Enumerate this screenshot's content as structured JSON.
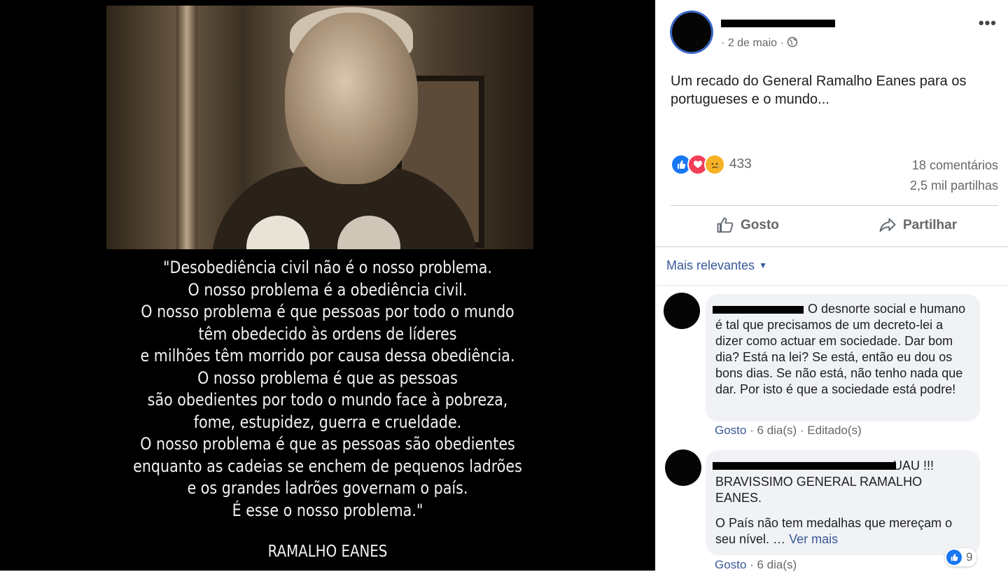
{
  "media": {
    "quote": "\"Desobediência civil não é o nosso problema.\nO nosso problema é a obediência civil.\nO nosso problema é que pessoas por todo o mundo\ntêm obedecido às ordens de líderes\ne milhões têm morrido por causa dessa obediência.\nO nosso problema é que as pessoas\nsão obedientes por todo o mundo face à pobreza,\nfome, estupidez, guerra e crueldade.\nO nosso problema é que as pessoas são obedientes\nenquanto as cadeias se enchem de pequenos ladrões\ne os grandes ladrões governam o país.\nÉ esse o nosso problema.\"",
    "author": "RAMALHO EANES"
  },
  "post": {
    "date": "· 2 de maio ·",
    "globe_icon": "globe-icon",
    "more_label": "•••",
    "text": "Um recado do General Ramalho Eanes para os portugueses e o mundo...",
    "reaction_icons": [
      "like-icon",
      "love-icon",
      "sad-icon"
    ],
    "reaction_count": "433",
    "comments_count": "18 comentários",
    "shares_count": "2,5 mil partilhas",
    "like_label": "Gosto",
    "share_label": "Partilhar",
    "sort_label": "Mais relevantes"
  },
  "comments": [
    {
      "text": "O desnorte social e humano é tal que precisamos de um decreto-lei a dizer como actuar em sociedade. Dar bom dia? Está na lei? Se está, então eu dou os bons dias. Se não está, não tenho nada que dar. Por isto é que a sociedade está podre!",
      "like_label": "Gosto",
      "meta": "· 6 dia(s) · Editado(s)"
    },
    {
      "text": "UAU !!! BRAVISSIMO GENERAL RAMALHO EANES.",
      "text2": "O País não tem medalhas que mereçam o seu nível. …",
      "see_more": "Ver mais",
      "like_label": "Gosto",
      "meta": "· 6 dia(s)",
      "likes": "9"
    }
  ],
  "colors": {
    "link": "#385898",
    "like_blue": "#1877f2",
    "love_red": "#f33e58",
    "sad_yellow": "#f7b125"
  }
}
